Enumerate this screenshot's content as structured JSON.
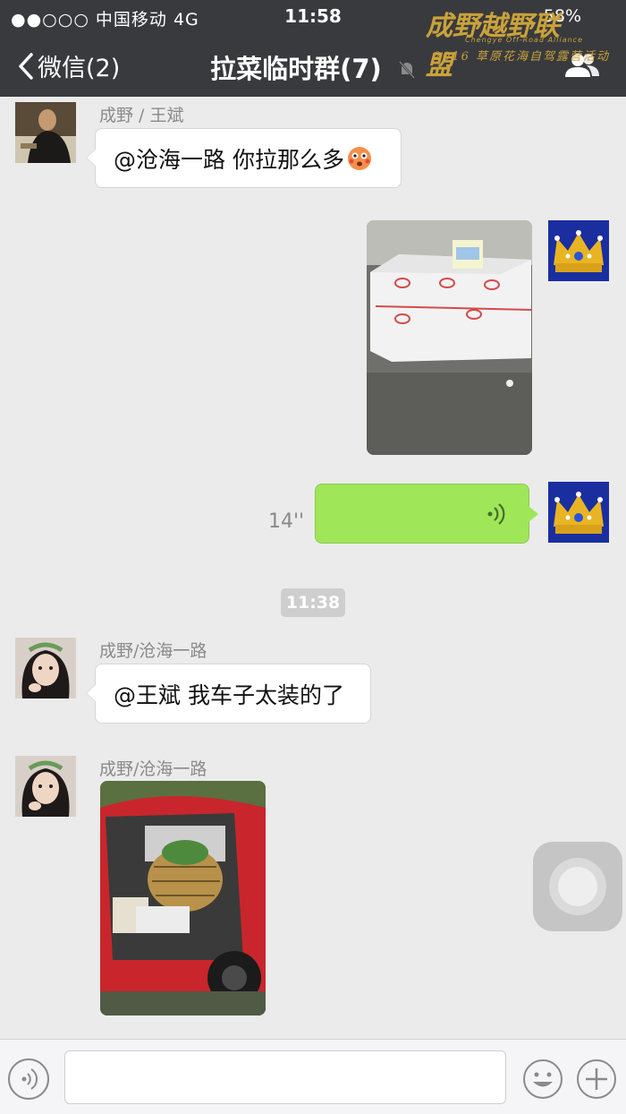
{
  "status_bar": {
    "signal": "●●○○○ 中国移动  4G",
    "time": "11:58",
    "battery": "58%"
  },
  "nav": {
    "back_label": "微信(2)",
    "title": "拉菜临时群(7)"
  },
  "watermark": {
    "brand": "成野越野联盟",
    "sub": "Chengye Off-Road Alliance",
    "line2": "2016 草原花海自驾露营活动"
  },
  "messages": [
    {
      "sender": "成野 / 王斌",
      "text": "@沧海一路 你拉那么多"
    },
    {
      "type": "image",
      "desc": "foam box"
    },
    {
      "type": "voice",
      "duration": "14''"
    },
    {
      "timestamp": "11:38"
    },
    {
      "sender": "成野/沧海一路",
      "text": "@王斌 我车子太装的了"
    },
    {
      "sender": "成野/沧海一路",
      "type": "image"
    }
  ],
  "input": {
    "placeholder": ""
  },
  "colors": {
    "nav_bg": "#393a3e",
    "chat_bg": "#ebebeb",
    "voice_bubble": "#9fe658",
    "watermark": "#c9a23a"
  }
}
